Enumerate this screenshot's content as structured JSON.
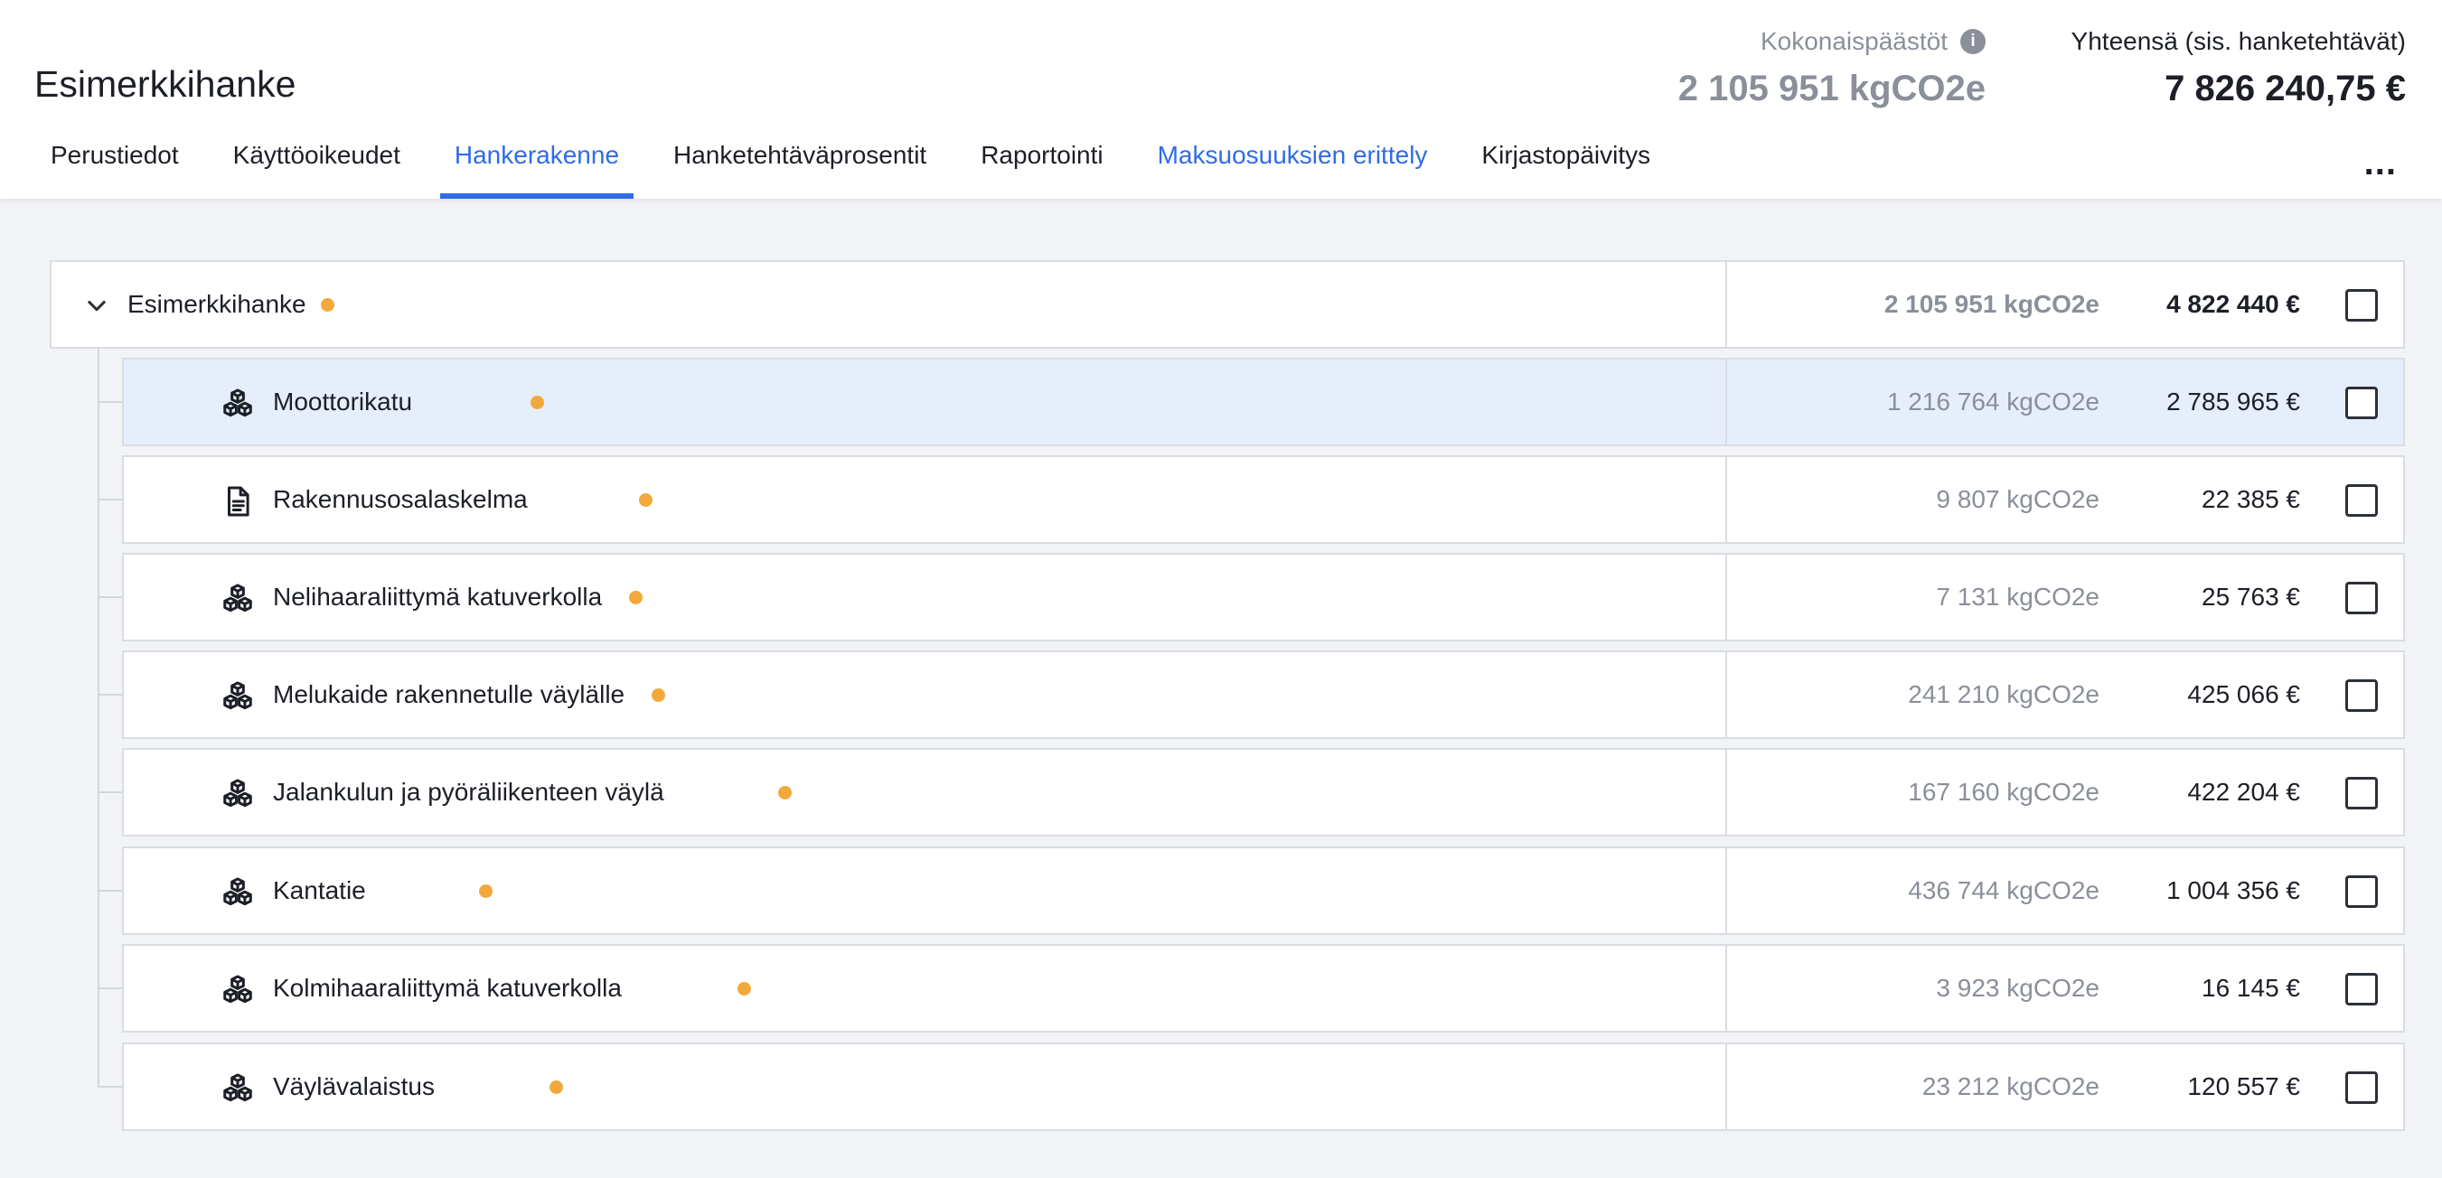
{
  "project": {
    "title": "Esimerkkihanke"
  },
  "summary": {
    "emissions_label": "Kokonaispäästöt",
    "emissions_value": "2 105 951 kgCO2e",
    "total_label": "Yhteensä (sis. hanketehtävät)",
    "total_value": "7 826 240,75 €"
  },
  "tabs": [
    {
      "label": "Perustiedot",
      "state": "default"
    },
    {
      "label": "Käyttöoikeudet",
      "state": "default"
    },
    {
      "label": "Hankerakenne",
      "state": "active"
    },
    {
      "label": "Hanketehtäväprosentit",
      "state": "default"
    },
    {
      "label": "Raportointi",
      "state": "default"
    },
    {
      "label": "Maksuosuuksien erittely",
      "state": "link"
    },
    {
      "label": "Kirjastopäivitys",
      "state": "default"
    }
  ],
  "more_label": "...",
  "colors": {
    "accent": "#2f6ce5",
    "status_dot": "#f2a93b",
    "selected_row": "#e6eefb",
    "muted_text": "#8a8f99"
  },
  "tree": {
    "root": {
      "name": "Esimerkkihanke",
      "emissions": "2 105 951 kgCO2e",
      "cost": "4 822 440 €",
      "expanded": true,
      "checked": false
    },
    "children": [
      {
        "name": "Moottorikatu",
        "icon": "cubes-icon",
        "emissions": "1 216 764 kgCO2e",
        "cost": "2 785 965 €",
        "selected": true,
        "checked": false
      },
      {
        "name": "Rakennusosalaskelma",
        "icon": "document-icon",
        "emissions": "9 807 kgCO2e",
        "cost": "22 385 €",
        "selected": false,
        "checked": false
      },
      {
        "name": "Nelihaaraliittymä katuverkolla",
        "icon": "cubes-icon",
        "emissions": "7 131 kgCO2e",
        "cost": "25 763 €",
        "selected": false,
        "checked": false
      },
      {
        "name": "Melukaide rakennetulle väylälle",
        "icon": "cubes-icon",
        "emissions": "241 210 kgCO2e",
        "cost": "425 066 €",
        "selected": false,
        "checked": false
      },
      {
        "name": "Jalankulun ja pyöräliikenteen väylä",
        "icon": "cubes-icon",
        "emissions": "167 160 kgCO2e",
        "cost": "422 204 €",
        "selected": false,
        "checked": false
      },
      {
        "name": "Kantatie",
        "icon": "cubes-icon",
        "emissions": "436 744 kgCO2e",
        "cost": "1 004 356 €",
        "selected": false,
        "checked": false
      },
      {
        "name": "Kolmihaaraliittymä katuverkolla",
        "icon": "cubes-icon",
        "emissions": "3 923 kgCO2e",
        "cost": "16 145 €",
        "selected": false,
        "checked": false
      },
      {
        "name": "Väylävalaistus",
        "icon": "cubes-icon",
        "emissions": "23 212 kgCO2e",
        "cost": "120 557 €",
        "selected": false,
        "checked": false
      }
    ]
  }
}
